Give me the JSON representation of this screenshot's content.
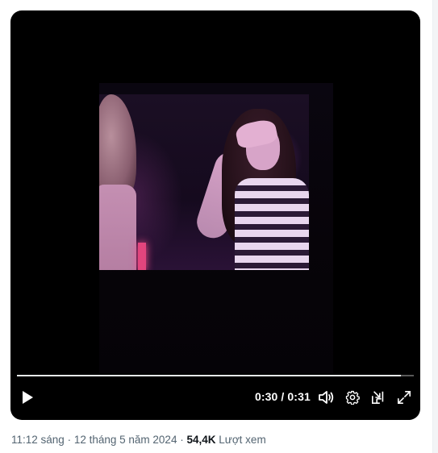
{
  "player": {
    "current_time": "0:30",
    "separator": "/",
    "duration": "0:31",
    "progress_fraction": 0.968
  },
  "tweet_meta": {
    "time": "11:12 sáng",
    "dot1": "·",
    "date": "12 tháng 5 năm 2024",
    "dot2": "·",
    "view_count": "54,4K",
    "views_label": "Lượt xem"
  },
  "icons": {
    "play": "play-icon",
    "volume": "volume-icon",
    "settings": "gear-icon",
    "pip": "picture-in-picture-icon",
    "fullscreen": "fullscreen-icon"
  },
  "colors": {
    "player_bg": "#000000",
    "meta_text": "#536471",
    "meta_strong": "#0f1419"
  }
}
